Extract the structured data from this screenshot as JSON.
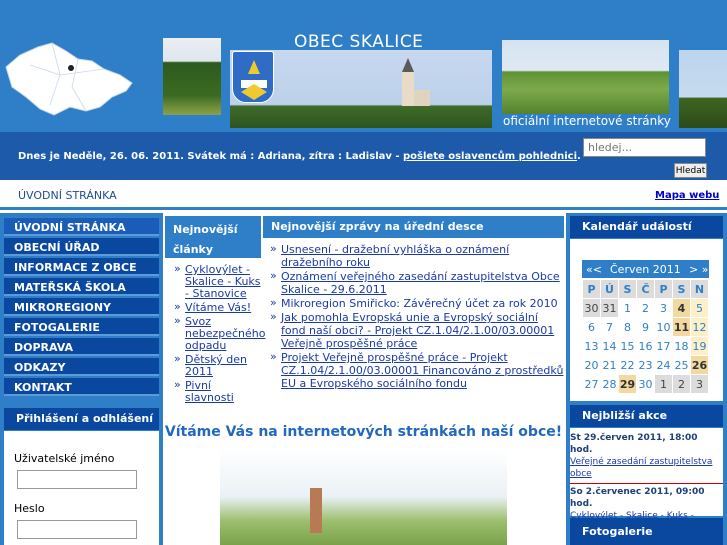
{
  "header": {
    "title": "OBEC SKALICE",
    "tagline": "oficiální internetové stránky"
  },
  "infobar": {
    "date_text": "Dnes je Neděle, 26. 06. 2011. Svátek má : Adriana, zítra : Ladislav - ",
    "greeting_link": "pošlete oslavencům pohlednici",
    "greeting_suffix": ".",
    "search_placeholder": "hledej...",
    "search_button": "Hledat"
  },
  "topnav": {
    "home": "ÚVODNÍ STRÁNKA",
    "sitemap": "Mapa webu"
  },
  "menu": {
    "items": [
      {
        "label": "ÚVODNÍ STRÁNKA"
      },
      {
        "label": "OBECNÍ ÚŘAD"
      },
      {
        "label": "INFORMACE Z OBCE"
      },
      {
        "label": "MATEŘSKÁ ŠKOLA"
      },
      {
        "label": "MIKROREGIONY"
      },
      {
        "label": "FOTOGALERIE"
      },
      {
        "label": "DOPRAVA"
      },
      {
        "label": "ODKAZY"
      },
      {
        "label": "KONTAKT"
      }
    ]
  },
  "login": {
    "title": "Přihlášení a odhlášení",
    "username_label": "Uživatelské jméno",
    "password_label": "Heslo"
  },
  "articles": {
    "title": "Nejnovější články",
    "items": [
      "Cyklovýlet - Skalice - Kuks - Stanovice",
      "Vítáme Vás!",
      "Svoz nebezpečného odpadu",
      "Dětský den 2011",
      "Pivní slavnosti"
    ]
  },
  "news": {
    "title": "Nejnovější zprávy na úřední desce",
    "items": [
      {
        "text": "Usnesení - dražební vyhláška o oznámení dražebního roku",
        "link": true
      },
      {
        "text": "Oznámení veřejného zasedání zastupitelstva Obce Skalice - 29.6.2011",
        "link": true
      },
      {
        "text": "Mikroregion Smiřicko: Závěrečný účet za rok 2010",
        "link": false
      },
      {
        "text": "Jak pomohla Evropská unie a Evropský sociální fond naší obci? - Projekt CZ.1.04/2.1.00/03.00001 Veřejně prospěšné práce",
        "link": true
      },
      {
        "text": "Projekt Veřejně prospěšné práce - Projekt CZ.1.04/2.1.00/03.00001 Financováno z prostředků EU a Evropského sociálního fondu",
        "link": true
      }
    ]
  },
  "main": {
    "welcome": "Vítáme Vás na internetových stránkách naší obce!"
  },
  "calendar": {
    "title": "Kalendář událostí",
    "prev": "«<",
    "month": "Červen 2011",
    "next": "> »",
    "weekdays": [
      "P",
      "Ú",
      "S",
      "Č",
      "P",
      "S",
      "N"
    ],
    "weeks": [
      [
        "30",
        "31",
        "1",
        "2",
        "3",
        "4",
        "5"
      ],
      [
        "6",
        "7",
        "8",
        "9",
        "10",
        "11",
        "12"
      ],
      [
        "13",
        "14",
        "15",
        "16",
        "17",
        "18",
        "19"
      ],
      [
        "20",
        "21",
        "22",
        "23",
        "24",
        "25",
        "26"
      ],
      [
        "27",
        "28",
        "29",
        "30",
        "1",
        "2",
        "3"
      ]
    ]
  },
  "actions": {
    "title": "Nejbližší akce",
    "items": [
      {
        "date": "St 29.červen 2011, 18:00 hod.",
        "text": "Veřejné zasedání zastupitelstva obce"
      },
      {
        "date": "So 2.červenec 2011, 09:00 hod.",
        "text": "Cyklovýlet - Skalice - Kuks - Stanovice"
      }
    ]
  },
  "gallery": {
    "title": "Fotogalerie"
  }
}
